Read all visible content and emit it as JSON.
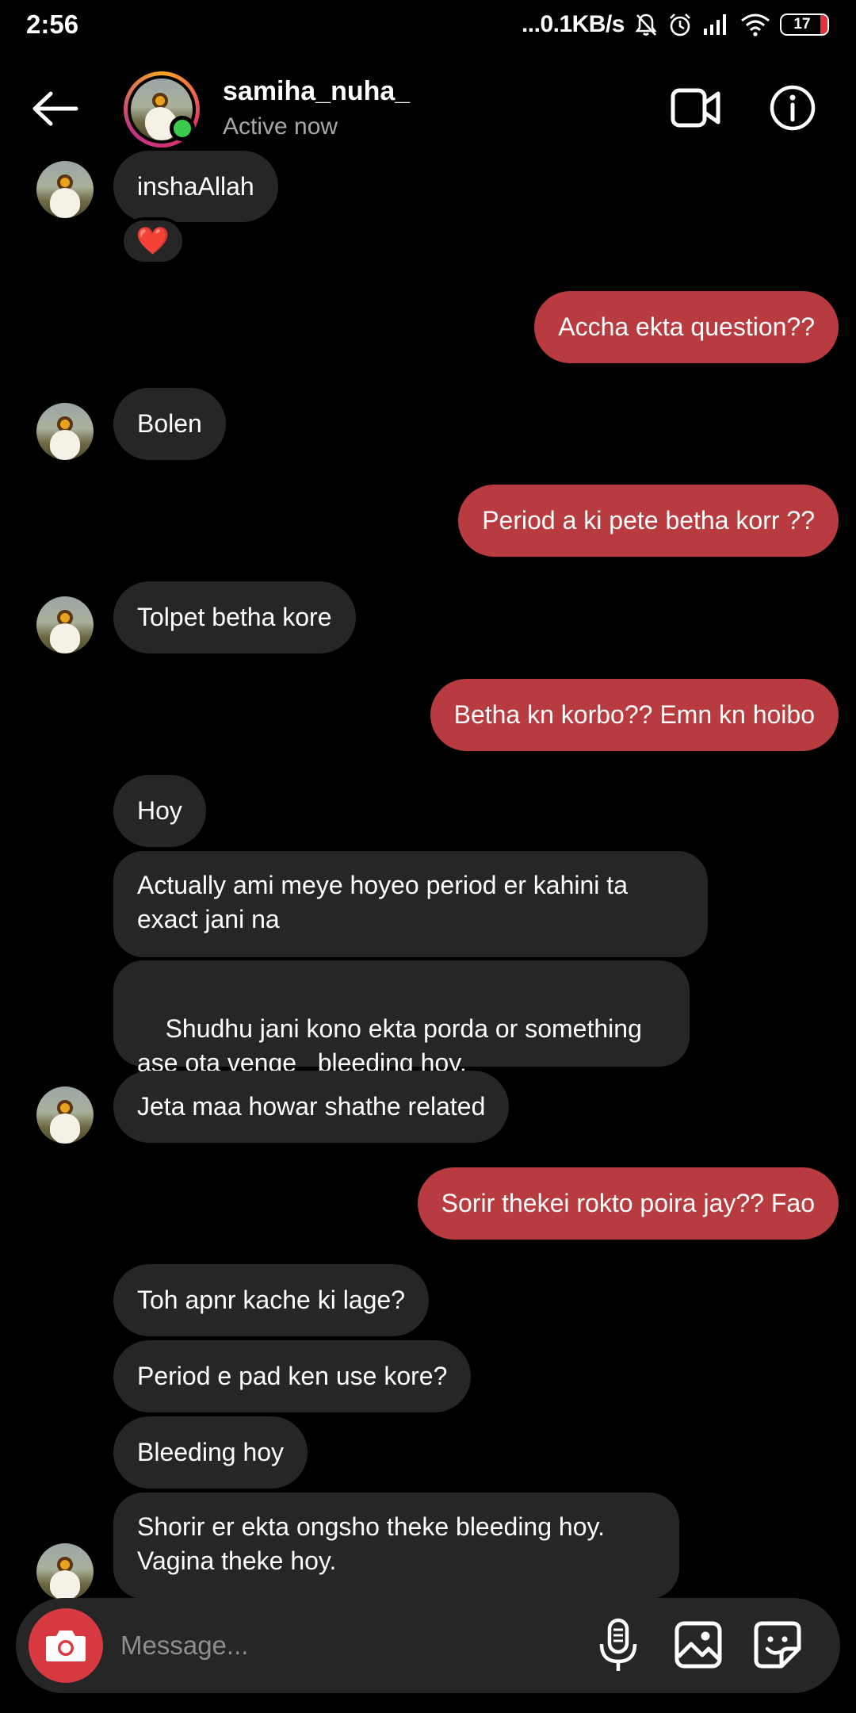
{
  "status_bar": {
    "time": "2:56",
    "network_speed": "...0.1KB/s",
    "battery": "17"
  },
  "header": {
    "contact_name": "samiha_nuha_",
    "contact_status": "Active now",
    "icons": [
      "back-arrow-icon",
      "video-call-icon",
      "info-icon"
    ]
  },
  "messages": [
    {
      "side": "in",
      "text": "inshaAllah",
      "reaction": "❤️"
    },
    {
      "side": "out",
      "text": "Accha ekta question??"
    },
    {
      "side": "in",
      "text": "Bolen"
    },
    {
      "side": "out",
      "text": "Period a ki pete betha korr ??"
    },
    {
      "side": "in",
      "text": "Tolpet betha kore"
    },
    {
      "side": "out",
      "text": "Betha kn korbo?? Emn kn hoibo"
    },
    {
      "side": "in",
      "text": "Hoy"
    },
    {
      "side": "in",
      "text": "Actually ami meye hoyeo period er kahini ta exact jani na"
    },
    {
      "side": "in",
      "text": "Shudhu jani kono ekta porda or something ase ota venge   bleeding hoy."
    },
    {
      "side": "in",
      "text": "Jeta maa howar shathe related"
    },
    {
      "side": "out",
      "text": "Sorir thekei rokto poira jay?? Fao"
    },
    {
      "side": "in",
      "text": "Toh apnr kache ki lage?"
    },
    {
      "side": "in",
      "text": "Period e pad ken use kore?"
    },
    {
      "side": "in",
      "text": "Bleeding hoy"
    },
    {
      "side": "in",
      "text": "Shorir er ekta ongsho theke bleeding hoy. Vagina theke hoy."
    }
  ],
  "composer": {
    "placeholder": "Message...",
    "icons": [
      "camera-icon",
      "microphone-icon",
      "gallery-icon",
      "sticker-icon"
    ]
  },
  "colors": {
    "background": "#000000",
    "incoming_bubble": "#262626",
    "outgoing_bubble": "#b83b3f",
    "camera_button": "#d6393f",
    "online_dot": "#3ccb4c"
  }
}
